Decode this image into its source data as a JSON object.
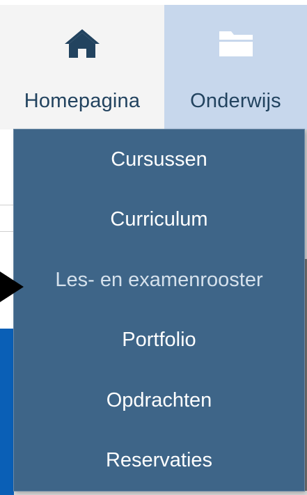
{
  "nav": {
    "tabs": [
      {
        "label": "Homepagina",
        "icon": "home-icon"
      },
      {
        "label": "Onderwijs",
        "icon": "folder-icon",
        "active": true
      }
    ]
  },
  "dropdown": {
    "items": [
      {
        "label": "Cursussen"
      },
      {
        "label": "Curriculum"
      },
      {
        "label": "Les- en examenrooster"
      },
      {
        "label": "Portfolio"
      },
      {
        "label": "Opdrachten"
      },
      {
        "label": "Reservaties"
      }
    ]
  },
  "colors": {
    "tab_text": "#22435f",
    "active_tab_bg": "#c7d7ec",
    "inactive_tab_bg": "#f4f4f4",
    "menu_bg": "#3e6588",
    "menu_text": "#ffffff",
    "accent_blue": "#0a5fb6"
  }
}
